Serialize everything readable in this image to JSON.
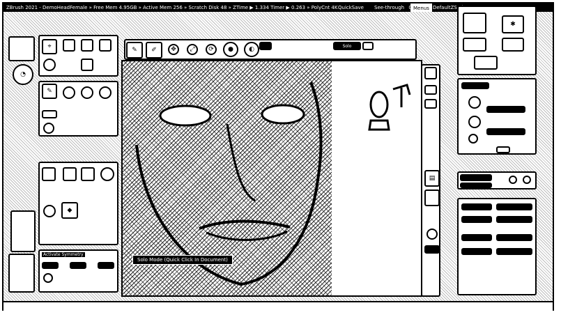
{
  "titlebar": {
    "text": "ZBrush 2021 - DemoHeadFemale  » Free Mem 4.95GB » Active Mem 256 » Scratch Disk 48 » ZTime ▶ 1.334 Timer ▶ 0.263 » PolyCnt 4K",
    "quicksave_label": "QuickSave",
    "seethrough_label": "See-through",
    "seethrough_value": "0",
    "menus_label": "Menus",
    "script_label": "DefaultZScript"
  },
  "tooltip": {
    "text": "Solo Mode (Quick Click In Document)"
  },
  "left_panel": {
    "activate_symmetry_label": "Activate Symmetry"
  },
  "top_shelf": {
    "dropdown_label": "Solo"
  },
  "icons": {
    "edit": "pencil-icon",
    "draw": "draw-icon",
    "move": "move-icon",
    "scale": "scale-icon",
    "rotate": "rotate-icon"
  }
}
